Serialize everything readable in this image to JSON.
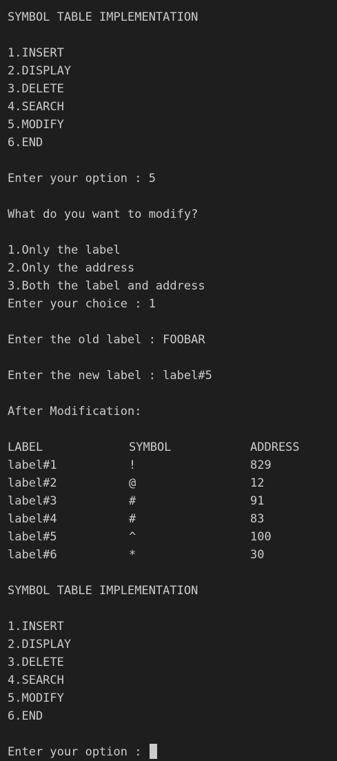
{
  "terminal": {
    "header1": "SYMBOL TABLE IMPLEMENTATION",
    "menu1": [
      "1.INSERT",
      "2.DISPLAY",
      "3.DELETE",
      "4.SEARCH",
      "5.MODIFY",
      "6.END"
    ],
    "option_prompt": "Enter your option : 5",
    "modify_question": "What do you want to modify?",
    "modify_choices": [
      "1.Only the label",
      "2.Only the address",
      "3.Both the label and address"
    ],
    "choice_prompt": "Enter your choice : 1",
    "old_label_prompt": "Enter the old label : FOOBAR",
    "new_label_prompt": "Enter the new label : label#5",
    "after_modification": "After Modification:",
    "table": {
      "headers": [
        "LABEL",
        "SYMBOL",
        "ADDRESS"
      ],
      "rows": [
        [
          "label#1",
          "!",
          "829"
        ],
        [
          "label#2",
          "@",
          "12"
        ],
        [
          "label#3",
          "#",
          "91"
        ],
        [
          "label#4",
          "#",
          "83"
        ],
        [
          "label#5",
          "^",
          "100"
        ],
        [
          "label#6",
          "*",
          "30"
        ]
      ]
    },
    "header2": "SYMBOL TABLE IMPLEMENTATION",
    "menu2": [
      "1.INSERT",
      "2.DISPLAY",
      "3.DELETE",
      "4.SEARCH",
      "5.MODIFY",
      "6.END"
    ],
    "final_prompt": "Enter your option : "
  }
}
